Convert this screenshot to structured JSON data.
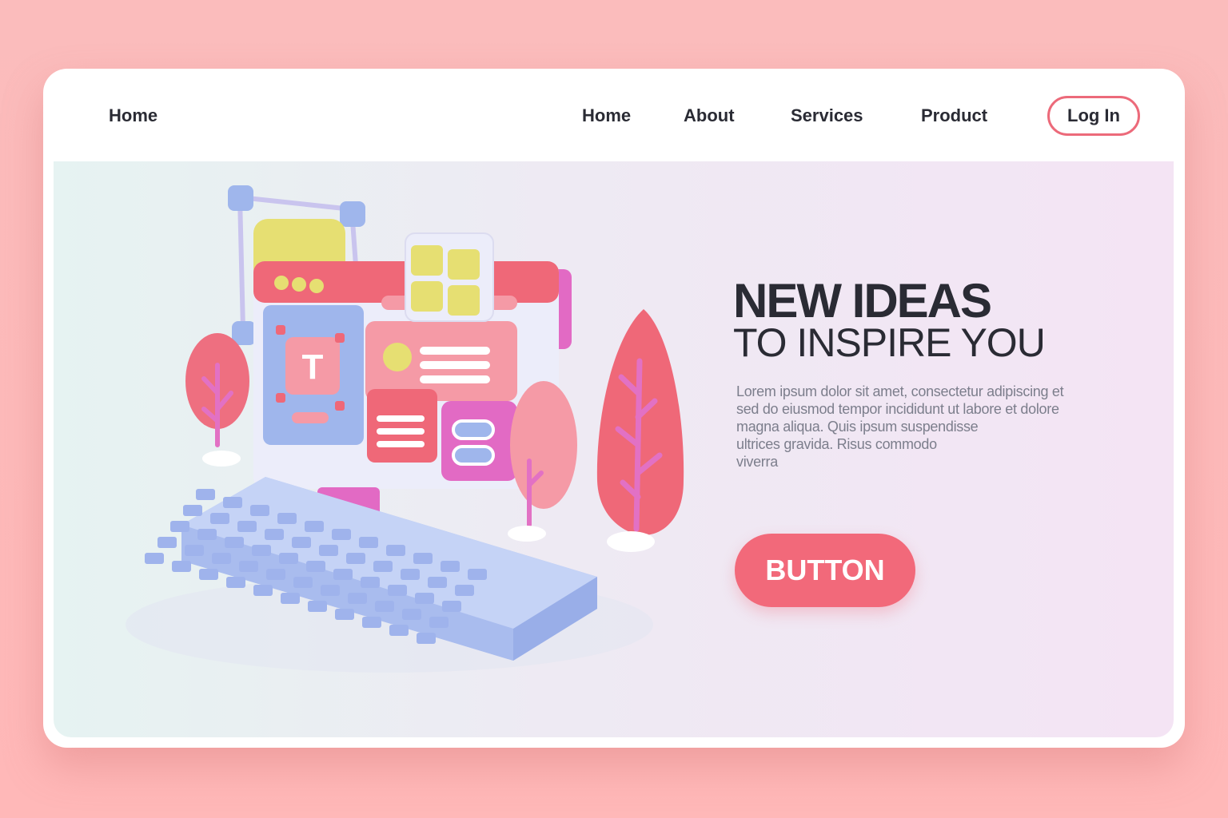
{
  "nav": {
    "logo_label": "Home",
    "links": [
      {
        "label": "Home"
      },
      {
        "label": "About"
      },
      {
        "label": "Services"
      },
      {
        "label": "Product"
      }
    ],
    "login_label": "Log In"
  },
  "hero": {
    "headline_line1": "NEW IDEAS",
    "headline_line2": "TO INSPIRE YOU",
    "body_lines": [
      "Lorem ipsum dolor sit amet, consectetur adipiscing et",
      "sed do eiusmod tempor incididunt ut labore et dolore",
      "magna aliqua. Quis ipsum suspendisse",
      "ultrices gravida. Risus commodo",
      "viverra"
    ],
    "button_label": "BUTTON",
    "illustration_letter": "T"
  },
  "colors": {
    "accent": "#f2697a",
    "background": "#ffb8b8",
    "text": "#2a2b34"
  }
}
